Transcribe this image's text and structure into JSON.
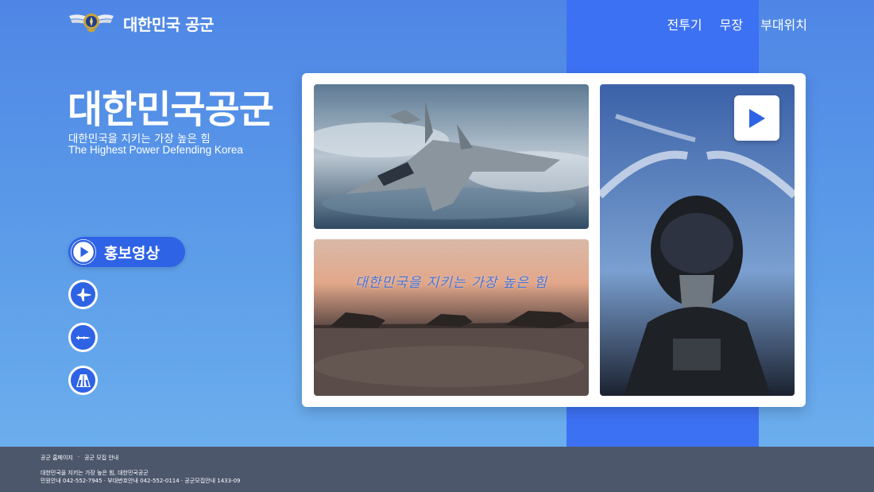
{
  "header": {
    "logo_text": "대한민국 공군",
    "nav": [
      "전투기",
      "무장",
      "부대위치"
    ]
  },
  "hero": {
    "title": "대한민국공군",
    "subtitle_ko": "대한민국을 지키는 가장 높은 힘",
    "subtitle_en": "The Highest Power Defending Korea"
  },
  "side_buttons": {
    "promo_label": "홍보영상",
    "icons": [
      "jet-icon",
      "missile-icon",
      "location-icon"
    ]
  },
  "gallery": {
    "overlay_text": "대한민국을 지키는 가장 높은 힘",
    "video_icon": "play-icon"
  },
  "footer": {
    "links": [
      "공군 홈페이지",
      "·",
      "공군 모집 안내"
    ],
    "line1": "대한민국을 지키는 가장 높은 힘, 대한민국공군",
    "line2": "민원안내 042-552-7945  ·  부대번호안내 042-552-0114  ·  공군모집안내 1433-09"
  },
  "colors": {
    "background_top": "#4f86e6",
    "background_bottom": "#6fb2ee",
    "stripe": "#3d71f4",
    "button": "#2f63e6",
    "footer": "#4d576c"
  }
}
